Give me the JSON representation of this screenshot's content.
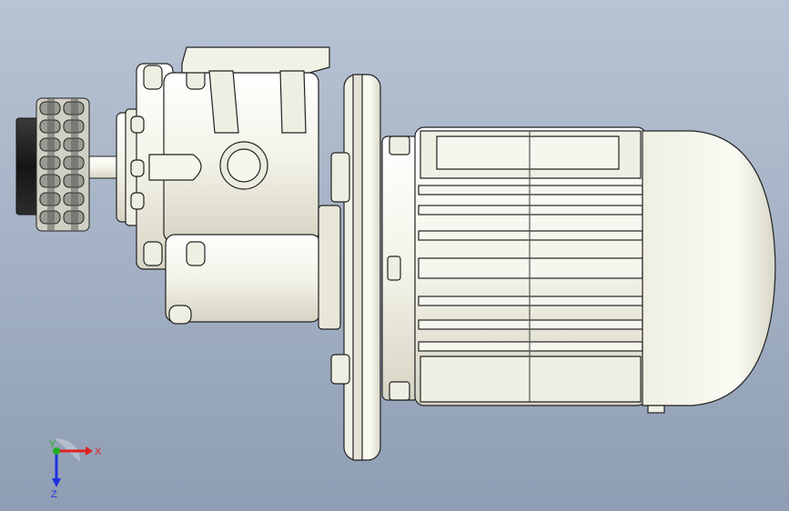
{
  "viewport": {
    "background_top": "#b8c4d4",
    "background_bottom": "#8e9db3",
    "model_fill": "#f4f3e8",
    "model_stroke": "#1f1f1f",
    "shadow_fill": "#d9d8c9"
  },
  "triad": {
    "x_label": "X",
    "y_label": "Y",
    "z_label": "Z",
    "x_color": "#e02020",
    "y_color": "#20b020",
    "z_color": "#2030e0"
  }
}
